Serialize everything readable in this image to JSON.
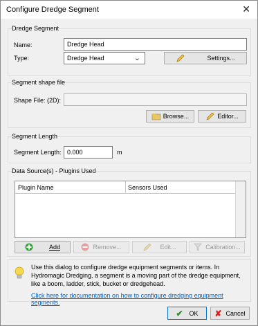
{
  "window": {
    "title": "Configure Dredge Segment"
  },
  "dredge_segment": {
    "group_label": "Dredge Segment",
    "name_label": "Name:",
    "name_value": "Dredge Head",
    "type_label": "Type:",
    "type_value": "Dredge Head",
    "settings_button": "Settings..."
  },
  "shape_file": {
    "group_label": "Segment shape file",
    "file_label": "Shape File: (2D):",
    "file_value": "",
    "browse_button": "Browse...",
    "editor_button": "Editor..."
  },
  "segment_length": {
    "group_label": "Segment Length",
    "length_label": "Segment Length:",
    "length_value": "0.000",
    "unit": "m"
  },
  "data_sources": {
    "group_label": "Data Source(s) - Plugins Used",
    "columns": [
      "Plugin Name",
      "Sensors Used"
    ],
    "rows": [],
    "buttons": {
      "add": "Add",
      "remove": "Remove...",
      "edit": "Edit...",
      "calibration": "Calibration..."
    }
  },
  "info": {
    "text": "Use this dialog to configure dredge equipment segments or items. In Hydromagic Dredging, a segment is a moving part of the dredge equipment, like a boom, ladder, stick, bucket or dredgehead.",
    "link": "Click here for documentation on how to configure dredging equipment segments."
  },
  "footer": {
    "ok": "OK",
    "cancel": "Cancel"
  },
  "colors": {
    "link": "#0066cc",
    "ok_check": "#2e8b2e",
    "cancel_x": "#d42020"
  }
}
